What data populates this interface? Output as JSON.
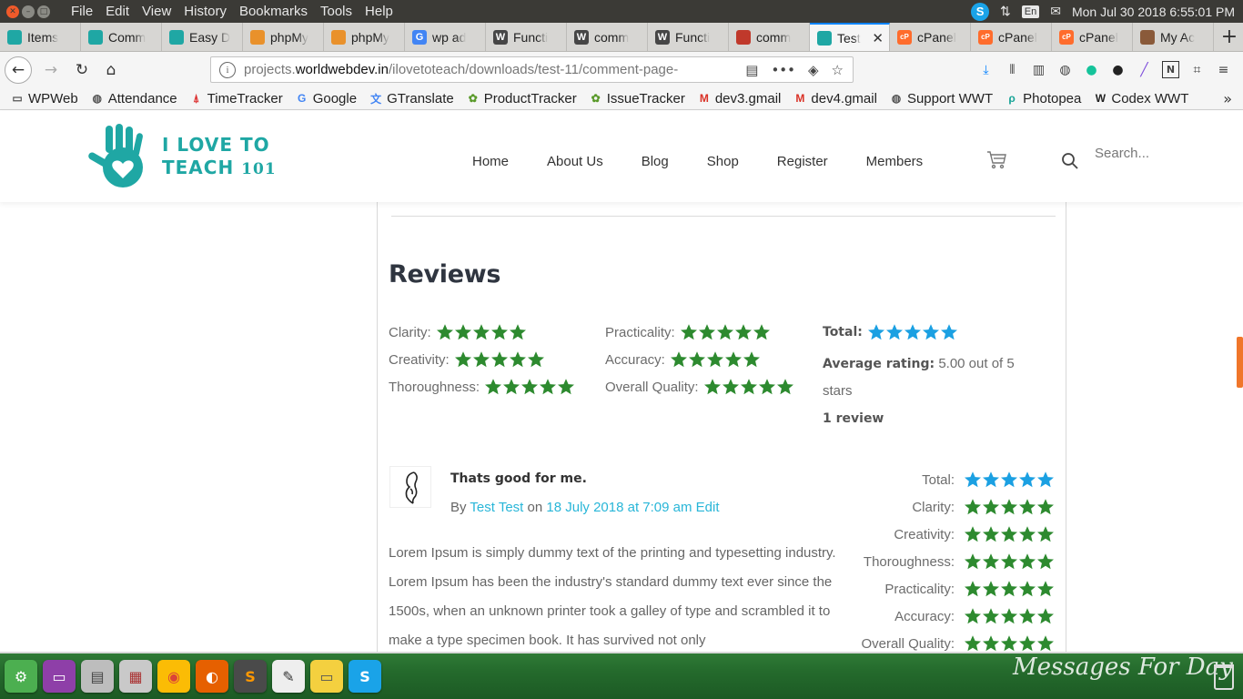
{
  "system": {
    "menu": [
      "File",
      "Edit",
      "View",
      "History",
      "Bookmarks",
      "Tools",
      "Help"
    ],
    "lang": "En",
    "clock": "Mon Jul 30 2018 6:55:01 PM"
  },
  "tabs": [
    {
      "label": "Items",
      "icon": "wptfav",
      "color": "#1fa7a4"
    },
    {
      "label": "Comm",
      "icon": "wptfav",
      "color": "#1fa7a4"
    },
    {
      "label": "Easy D",
      "icon": "wptfav",
      "color": "#1fa7a4"
    },
    {
      "label": "phpMy",
      "icon": "phpmyadmin",
      "color": "#e9912b"
    },
    {
      "label": "phpMy",
      "icon": "phpmyadmin",
      "color": "#e9912b"
    },
    {
      "label": "wp ad",
      "icon": "google",
      "color": "#4285f4"
    },
    {
      "label": "Functi",
      "icon": "wordpress",
      "color": "#464646"
    },
    {
      "label": "comm",
      "icon": "wordpress",
      "color": "#464646"
    },
    {
      "label": "Functi",
      "icon": "wordpress",
      "color": "#464646"
    },
    {
      "label": "comm",
      "icon": "bug",
      "color": "#c0392b"
    },
    {
      "label": "Test",
      "icon": "wptfav",
      "color": "#1fa7a4",
      "active": true
    },
    {
      "label": "cPanel",
      "icon": "cpanel",
      "color": "#ff6c2c"
    },
    {
      "label": "cPanel",
      "icon": "cpanel",
      "color": "#ff6c2c"
    },
    {
      "label": "cPanel",
      "icon": "cpanel",
      "color": "#ff6c2c"
    },
    {
      "label": "My Ac",
      "icon": "account",
      "color": "#8a5a3a"
    }
  ],
  "url": {
    "prefix": "projects.",
    "domain": "worldwebdev.in",
    "path": "/ilovetoteach/downloads/test-11/comment-page-"
  },
  "bookmarks": [
    {
      "label": "WPWeb",
      "icon": "folder-icon"
    },
    {
      "label": "Attendance",
      "icon": "globe-icon"
    },
    {
      "label": "TimeTracker",
      "icon": "timetracker-icon"
    },
    {
      "label": "Google",
      "icon": "google-icon"
    },
    {
      "label": "GTranslate",
      "icon": "translate-icon"
    },
    {
      "label": "ProductTracker",
      "icon": "bug-icon"
    },
    {
      "label": "IssueTracker",
      "icon": "bug-icon"
    },
    {
      "label": "dev3.gmail",
      "icon": "gmail-icon"
    },
    {
      "label": "dev4.gmail",
      "icon": "gmail-icon"
    },
    {
      "label": "Support WWT",
      "icon": "globe-icon"
    },
    {
      "label": "Photopea",
      "icon": "photopea-icon"
    },
    {
      "label": "Codex WWT",
      "icon": "wikipedia-icon"
    }
  ],
  "site": {
    "logo_line1": "I LOVE TO",
    "logo_line2": "TEACH",
    "logo_num": "101",
    "menu": [
      "Home",
      "About Us",
      "Blog",
      "Shop",
      "Register",
      "Members"
    ],
    "search_placeholder": "Search..."
  },
  "reviews": {
    "title": "Reviews",
    "col1": [
      {
        "label": "Clarity:",
        "stars": 5
      },
      {
        "label": "Creativity:",
        "stars": 5
      },
      {
        "label": "Thoroughness:",
        "stars": 5
      }
    ],
    "col2": [
      {
        "label": "Practicality:",
        "stars": 5
      },
      {
        "label": "Accuracy:",
        "stars": 5
      },
      {
        "label": "Overall Quality:",
        "stars": 5
      }
    ],
    "total_label": "Total:",
    "total_stars": 5,
    "avg_label": "Average rating:",
    "avg_value": "5.00 out of 5",
    "avg_suffix": "stars",
    "count": "1 review",
    "colors": {
      "green": "#2d8a2f",
      "blue": "#1ba0e2"
    }
  },
  "comment": {
    "title": "Thats good for me.",
    "by": "By",
    "author": "Test Test",
    "on": "on",
    "date": "18 July 2018 at 7:09 am",
    "edit": "Edit",
    "body": "Lorem Ipsum is simply dummy text of the printing and typesetting industry. Lorem Ipsum has been the industry's standard dummy text ever since the 1500s, when an unknown printer took a galley of type and scrambled it to make a type specimen book. It has survived not only",
    "ratings": [
      {
        "label": "Total:",
        "stars": 5,
        "color": "blue"
      },
      {
        "label": "Clarity:",
        "stars": 5,
        "color": "green"
      },
      {
        "label": "Creativity:",
        "stars": 5,
        "color": "green"
      },
      {
        "label": "Thoroughness:",
        "stars": 5,
        "color": "green"
      },
      {
        "label": "Practicality:",
        "stars": 5,
        "color": "green"
      },
      {
        "label": "Accuracy:",
        "stars": 5,
        "color": "green"
      },
      {
        "label": "Overall Quality:",
        "stars": 5,
        "color": "green"
      }
    ]
  },
  "dock": {
    "wallpaper_text": "Messages For Day"
  }
}
